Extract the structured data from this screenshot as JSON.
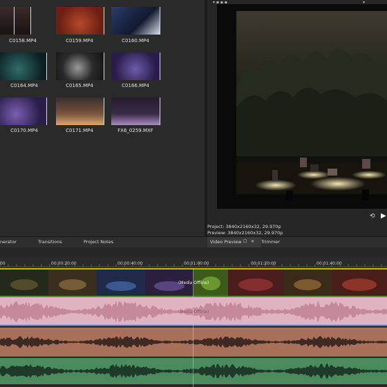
{
  "media_bin": {
    "clips": [
      {
        "name": "C0158.MP4"
      },
      {
        "name": "C0159.MP4"
      },
      {
        "name": "C0160.MP4"
      },
      {
        "name": "C0164.MP4"
      },
      {
        "name": "C0165.MP4"
      },
      {
        "name": "C0166.MP4"
      },
      {
        "name": "C0170.MP4"
      },
      {
        "name": "C0171.MP4"
      },
      {
        "name": "FX6_0259.MXF"
      }
    ]
  },
  "preview": {
    "project_info": "Project:  3840x2160x32, 29.970p",
    "preview_info": "Preview:  3840x2160x32, 29.970p"
  },
  "tabs": {
    "generator": "nerator",
    "transitions": "Transitions",
    "project_notes": "Project Notes",
    "video_preview": "Video Preview",
    "trimmer": "Trimmer"
  },
  "timeline": {
    "ruler": [
      "00",
      "00:00:20:00",
      "00:00:40:00",
      "00:01:00:00",
      "00:01:20:00",
      "00:01:40:00"
    ],
    "video_offline": "(Media Offline)",
    "audio_offline": "(Media Offline)"
  },
  "colors": {
    "accent_yellow": "#c6b800",
    "audio_pink": "#d7a9b6",
    "audio_brown": "#a06a55",
    "audio_green": "#3e7a52"
  }
}
